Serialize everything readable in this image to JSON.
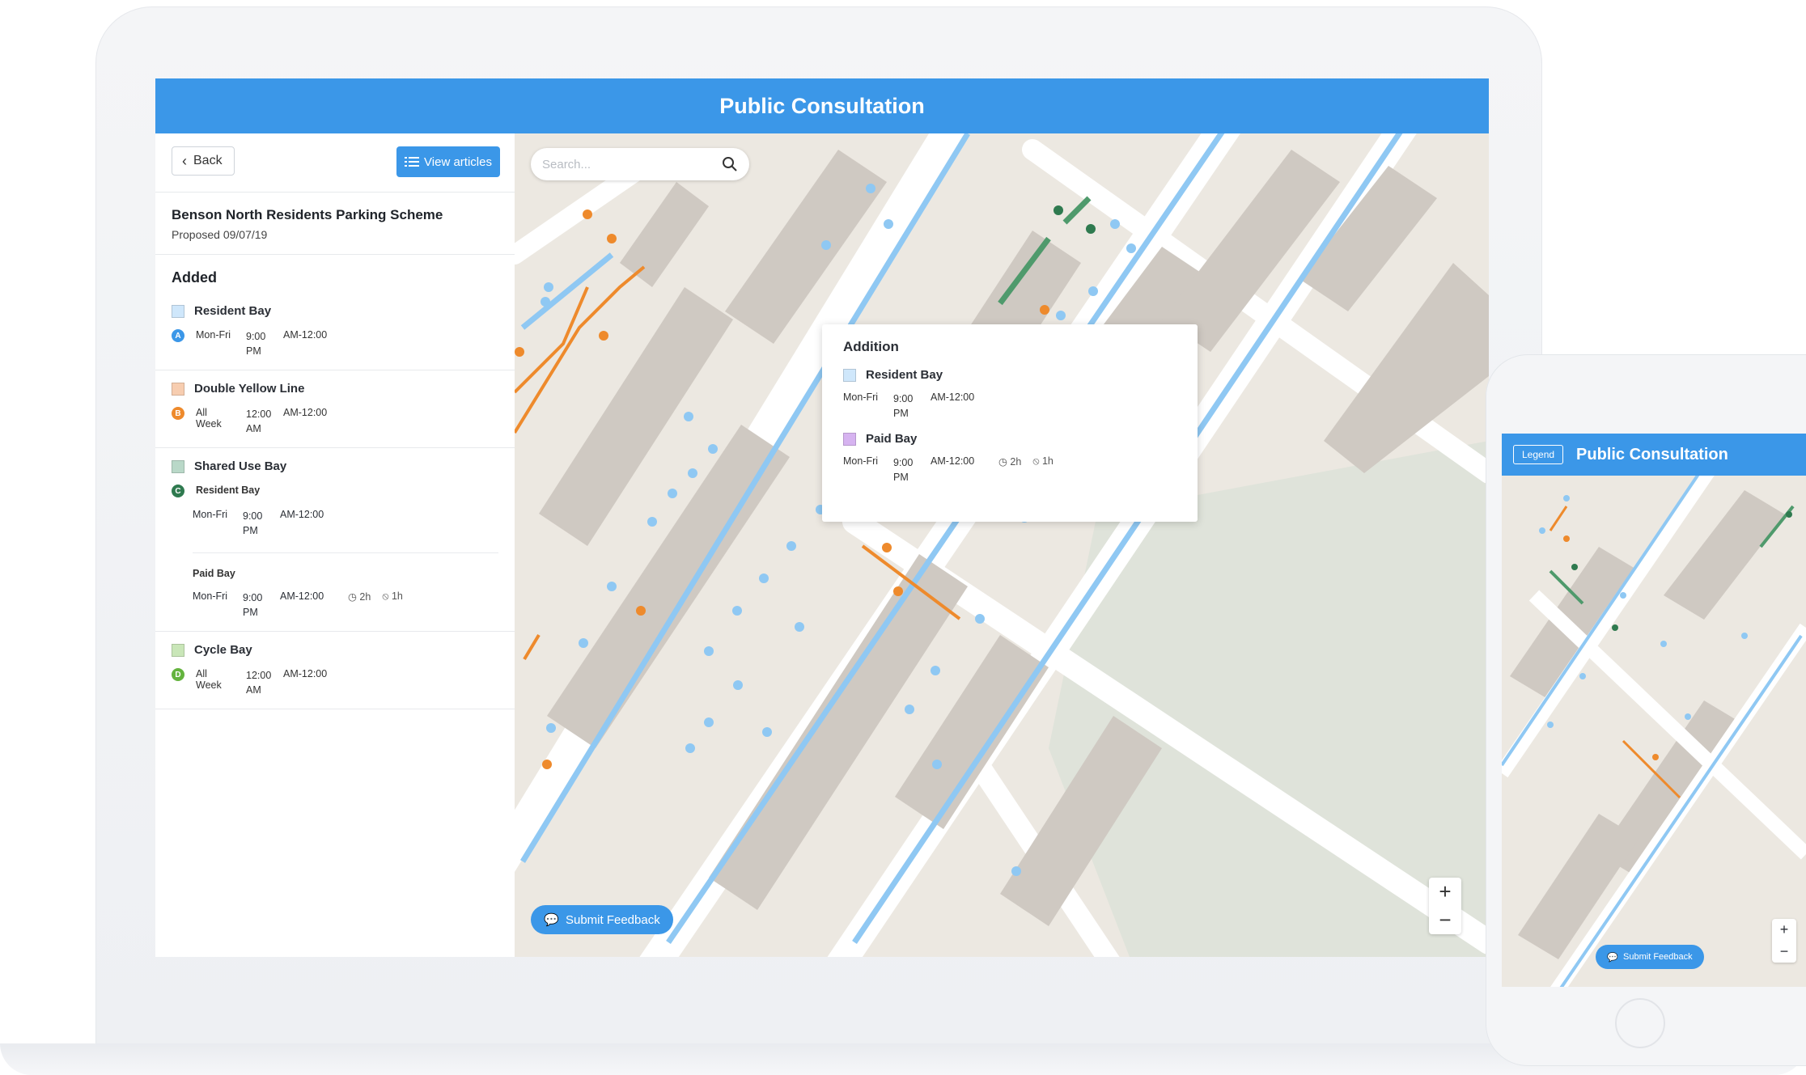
{
  "laptop": {
    "header_title": "Public Consultation",
    "back_label": "Back",
    "view_articles_label": "View articles",
    "search_placeholder": "Search...",
    "submit_feedback_label": "Submit Feedback",
    "zoom_in": "+",
    "zoom_out": "−"
  },
  "scheme": {
    "title": "Benson North Residents Parking Scheme",
    "subtitle": "Proposed 09/07/19"
  },
  "sidebar": {
    "section_title": "Added",
    "entries": [
      {
        "title": "Resident Bay",
        "color": "#cfe7fb",
        "badge": "A",
        "badge_color": "#3b97e8",
        "days": "Mon-Fri",
        "start": "9:00 PM",
        "end": "AM-12:00"
      },
      {
        "title": "Double Yellow Line",
        "color": "#f7cdb0",
        "badge": "B",
        "badge_color": "#ee8a2c",
        "days": "All Week",
        "start": "12:00 AM",
        "end": "AM-12:00"
      },
      {
        "title": "Shared Use Bay",
        "color": "#b9d8c8",
        "badge": "C",
        "badge_color": "#2f7a4f",
        "sub_a_title": "Resident Bay",
        "sub_a_days": "Mon-Fri",
        "sub_a_start": "9:00 PM",
        "sub_a_end": "AM-12:00",
        "sub_b_title": "Paid Bay",
        "sub_b_days": "Mon-Fri",
        "sub_b_start": "9:00 PM",
        "sub_b_end": "AM-12:00",
        "sub_b_max": "2h",
        "sub_b_noreturn": "1h"
      },
      {
        "title": "Cycle Bay",
        "color": "#c9e6b8",
        "badge": "D",
        "badge_color": "#64b33e",
        "days": "All Week",
        "start": "12:00 AM",
        "end": "AM-12:00"
      }
    ]
  },
  "popup": {
    "title": "Addition",
    "item1_title": "Resident Bay",
    "item1_color": "#cfe7fb",
    "item1_days": "Mon-Fri",
    "item1_start": "9:00 PM",
    "item1_end": "AM-12:00",
    "item2_title": "Paid Bay",
    "item2_color": "#d6b3f0",
    "item2_days": "Mon-Fri",
    "item2_start": "9:00 PM",
    "item2_end": "AM-12:00",
    "item2_max": "2h",
    "item2_noreturn": "1h"
  },
  "phone": {
    "legend_label": "Legend",
    "header_title": "Public Consultation",
    "submit_feedback_label": "Submit Feedback",
    "zoom_in": "+",
    "zoom_out": "−"
  },
  "icons": {
    "back": "chevron-left-icon",
    "articles": "list-icon",
    "search": "search-icon",
    "feedback": "chat-bubble-icon",
    "clock": "clock-icon",
    "no_return": "no-entry-icon"
  },
  "colors": {
    "brand_blue": "#3b97e8",
    "map_background": "#ece8e1",
    "building": "#cfc9c2",
    "road": "#ffffff",
    "resident_bay_line": "#8fc8f3",
    "yellow_line": "#ee8a2c",
    "shared_bay_line": "#4f9a6c"
  }
}
